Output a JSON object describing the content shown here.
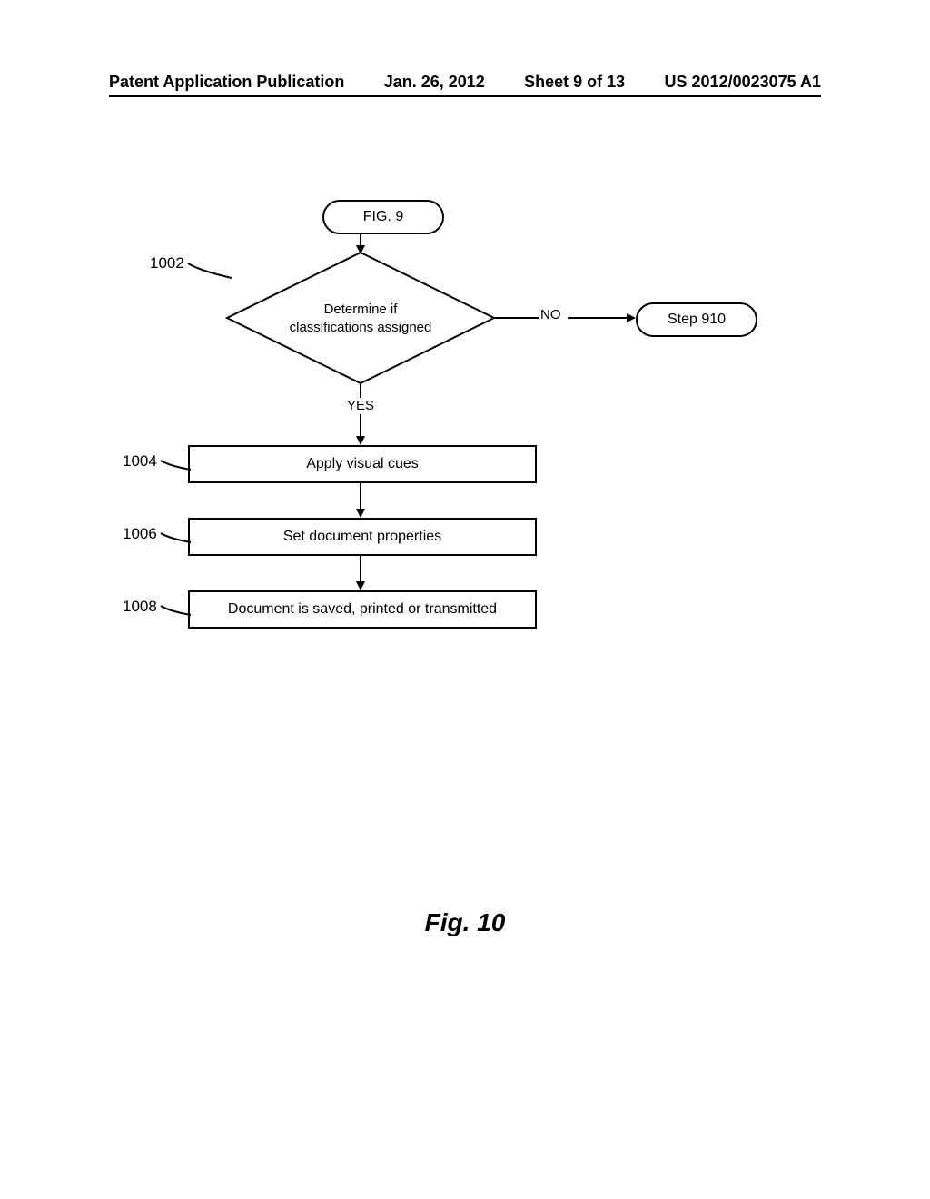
{
  "header": {
    "publication_type": "Patent Application Publication",
    "date": "Jan. 26, 2012",
    "sheet": "Sheet 9 of 13",
    "pub_number": "US 2012/0023075 A1"
  },
  "flowchart": {
    "start": "FIG. 9",
    "step_ref": "Step 910",
    "decision": {
      "ref": "1002",
      "text_line1": "Determine if",
      "text_line2": "classifications assigned",
      "yes": "YES",
      "no": "NO"
    },
    "step1": {
      "ref": "1004",
      "text": "Apply visual cues"
    },
    "step2": {
      "ref": "1006",
      "text": "Set document properties"
    },
    "step3": {
      "ref": "1008",
      "text": "Document is saved, printed or transmitted"
    }
  },
  "caption": "Fig. 10"
}
